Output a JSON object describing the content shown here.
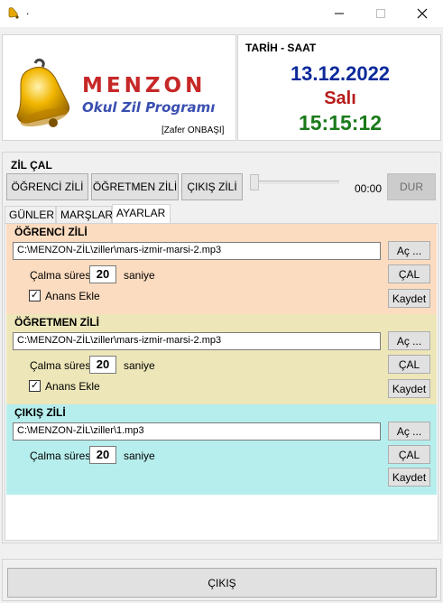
{
  "window": {
    "title": ".",
    "icon": "bell-app-icon"
  },
  "logo": {
    "title": "MENZON",
    "subtitle": "Okul Zil Programı",
    "author": "[Zafer ONBAŞI]",
    "colors": {
      "title": "#c62828",
      "subtitle": "#3a4fb0"
    }
  },
  "datetime": {
    "title": "TARİH - SAAT",
    "date": "13.12.2022",
    "day": "Salı",
    "time": "15:15:12",
    "colors": {
      "date": "#0b2a9a",
      "day": "#b71c1c",
      "time": "#1a7a1a"
    }
  },
  "ring": {
    "label": "ZİL ÇAL",
    "buttons": {
      "student": "ÖĞRENCİ ZİLİ",
      "teacher": "ÖĞRETMEN ZİLİ",
      "exit": "ÇIKIŞ ZİLİ",
      "stop": "DUR"
    },
    "elapsed": "00:00",
    "progress_percent": 0
  },
  "tabs": [
    {
      "label": "GÜNLER",
      "active": false
    },
    {
      "label": "MARŞLAR",
      "active": false
    },
    {
      "label": "AYARLAR",
      "active": true
    }
  ],
  "settings": {
    "student": {
      "title": "ÖĞRENCİ ZİLİ",
      "path": "C:\\MENZON-ZİL\\ziller\\mars-izmir-marsi-2.mp3",
      "browse": "Aç ...",
      "duration_label": "Çalma süresi:",
      "duration": "20",
      "unit": "saniye",
      "play": "ÇAL",
      "save": "Kaydet",
      "anthem_label": "Anans Ekle",
      "anthem_checked": true,
      "color": "#fcdcc0"
    },
    "teacher": {
      "title": "ÖĞRETMEN ZİLİ",
      "path": "C:\\MENZON-ZİL\\ziller\\mars-izmir-marsi-2.mp3",
      "browse": "Aç ...",
      "duration_label": "Çalma süresi:",
      "duration": "20",
      "unit": "saniye",
      "play": "ÇAL",
      "save": "Kaydet",
      "anthem_label": "Anans Ekle",
      "anthem_checked": true,
      "color": "#ede6b8"
    },
    "exit": {
      "title": "ÇIKIŞ ZİLİ",
      "path": "C:\\MENZON-ZİL\\ziller\\1.mp3",
      "browse": "Aç ...",
      "duration_label": "Çalma süresi:",
      "duration": "20",
      "unit": "saniye",
      "play": "ÇAL",
      "save": "Kaydet",
      "color": "#b6eeed"
    }
  },
  "footer": {
    "exit_label": "ÇIKIŞ"
  }
}
